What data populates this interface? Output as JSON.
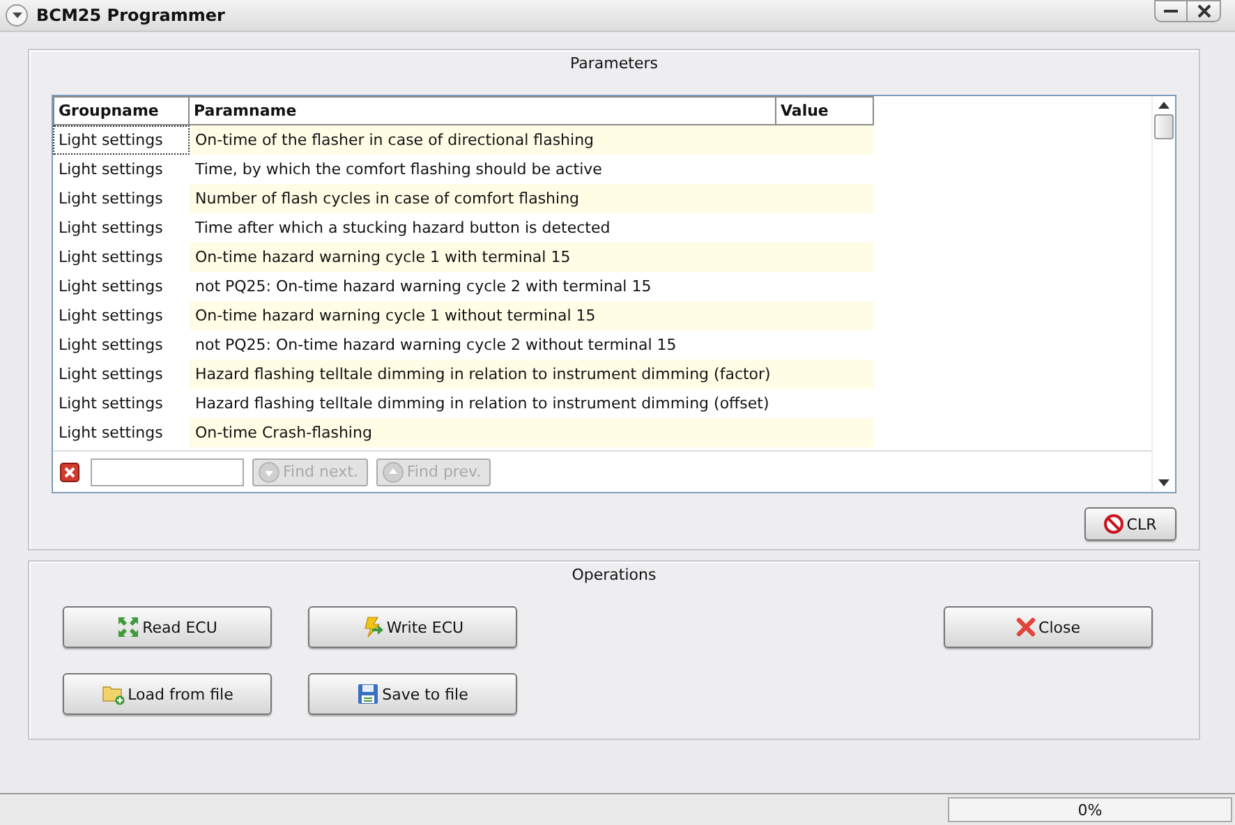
{
  "window": {
    "title": "BCM25 Programmer"
  },
  "parameters": {
    "title": "Parameters",
    "table": {
      "columns": [
        "Groupname",
        "Paramname",
        "Value"
      ],
      "rows": [
        {
          "group": "Light settings",
          "param": "On-time of the flasher in case of directional flashing",
          "selected": true
        },
        {
          "group": "Light settings",
          "param": "Time, by which the comfort flashing should be active",
          "selected": false
        },
        {
          "group": "Light settings",
          "param": "Number of flash cycles in case of comfort flashing",
          "selected": false
        },
        {
          "group": "Light settings",
          "param": "Time after which a stucking hazard button is detected",
          "selected": false
        },
        {
          "group": "Light settings",
          "param": "On-time hazard warning cycle 1 with terminal 15",
          "selected": false
        },
        {
          "group": "Light settings",
          "param": "not PQ25: On-time hazard warning cycle 2 with terminal 15",
          "selected": false
        },
        {
          "group": "Light settings",
          "param": "On-time hazard warning cycle 1 without terminal 15",
          "selected": false
        },
        {
          "group": "Light settings",
          "param": "not PQ25: On-time hazard warning cycle 2 without terminal 15",
          "selected": false
        },
        {
          "group": "Light settings",
          "param": "Hazard flashing telltale dimming in relation to instrument dimming (factor)",
          "selected": false
        },
        {
          "group": "Light settings",
          "param": "Hazard flashing telltale dimming in relation to instrument dimming (offset)",
          "selected": false
        },
        {
          "group": "Light settings",
          "param": "On-time Crash-flashing",
          "selected": false
        }
      ]
    },
    "search": {
      "find_next": {
        "label": "Find next.",
        "disabled": true
      },
      "find_prev": {
        "label": "Find prev.",
        "disabled": true
      }
    },
    "clear_button": "CLR"
  },
  "operations": {
    "title": "Operations",
    "buttons": [
      {
        "kind": "read",
        "label": "Read ECU"
      },
      {
        "kind": "write",
        "label": "Write ECU"
      },
      {
        "kind": "close",
        "label": "Close"
      },
      {
        "kind": "load",
        "label": "Load from file"
      },
      {
        "kind": "save",
        "label": "Save to file"
      }
    ]
  },
  "status_bar": {
    "progress": {
      "level": 0,
      "reading": "0%"
    }
  }
}
